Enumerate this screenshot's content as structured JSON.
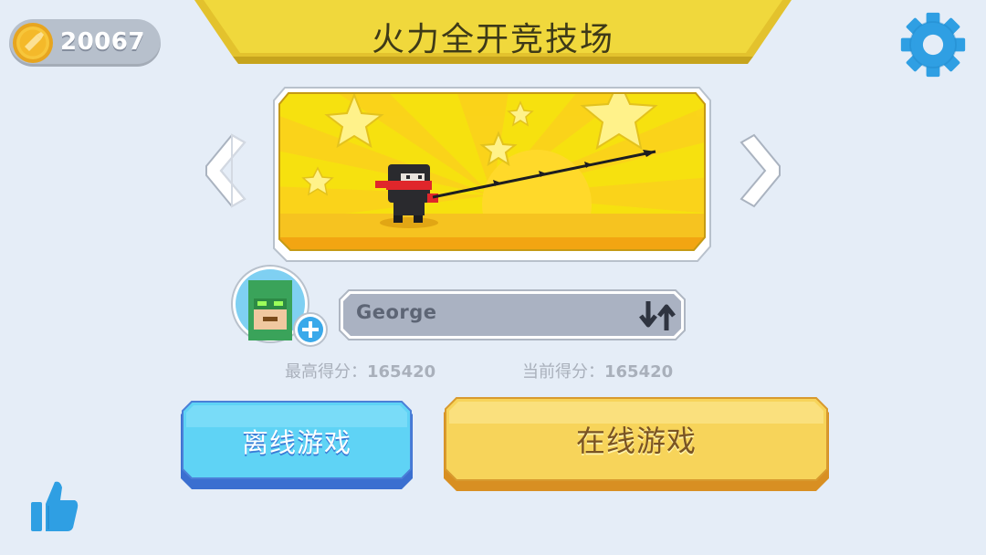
{
  "hud": {
    "coins": "20067"
  },
  "header": {
    "title": "火力全开竞技场"
  },
  "icons": {
    "coin": "coin-icon",
    "settings": "gear-icon",
    "left": "chevron-left-icon",
    "right": "chevron-right-icon",
    "swap": "swap-arrows-icon",
    "add": "plus-icon",
    "like": "thumbs-up-icon"
  },
  "player": {
    "name": "George"
  },
  "scores": {
    "best_label": "最高得分：",
    "best_value": "165420",
    "current_label": "当前得分：",
    "current_value": "165420"
  },
  "buttons": {
    "offline": "离线游戏",
    "online": "在线游戏"
  },
  "colors": {
    "background": "#e5edf7",
    "banner": "#efd53a",
    "offline_button": "#5fd3f5",
    "online_button": "#f7d45a",
    "accent_blue": "#2f9fe3"
  }
}
